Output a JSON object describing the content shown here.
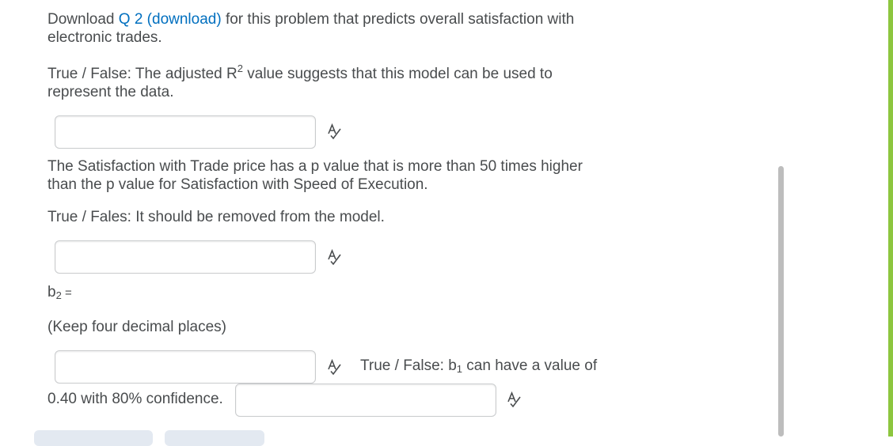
{
  "intro": {
    "before": "Download ",
    "link": "Q 2 (download)",
    "after": " for this problem that predicts overall satisfaction with electronic trades."
  },
  "q1": {
    "text_before": "True / False:  The adjusted R",
    "sup": "2",
    "text_after": " value suggests that this model can be used to represent the data.",
    "input_value": ""
  },
  "q2": {
    "statement": "The Satisfaction with Trade price has a p value that is more than 50 times higher than the p value for Satisfaction with Speed of Execution.",
    "question": "True / Fales:  It should be removed from the model.",
    "input_value": ""
  },
  "q3": {
    "label_main": "b",
    "label_sub": "2",
    "label_eq": " =",
    "hint": "(Keep four decimal places)",
    "input_value": ""
  },
  "q4": {
    "prefix": "True / False:  b",
    "sub": "1",
    "suffix": " can have a value of",
    "continuation": "0.40 with 80% confidence.",
    "input_value": ""
  },
  "icons": {
    "spellcheck": "spellcheck-icon"
  },
  "colors": {
    "link": "#006fbf",
    "text": "#494c4e",
    "accent": "#8dc63f"
  }
}
